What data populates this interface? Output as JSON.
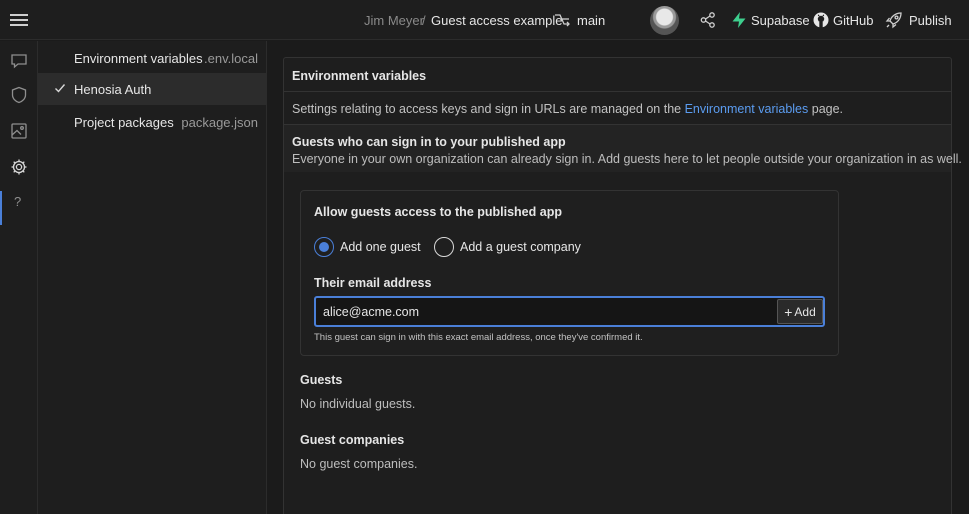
{
  "topbar": {
    "owner": "Jim Meyer",
    "separator": "/",
    "project": "Guest access example",
    "branch": "main",
    "actions": [
      {
        "label": "Supabase",
        "icon": "supabase-icon"
      },
      {
        "label": "GitHub",
        "icon": "github-icon"
      },
      {
        "label": "Publish",
        "icon": "rocket-icon"
      }
    ]
  },
  "rail": {
    "icons": [
      "chat-icon",
      "shield-icon",
      "image-icon",
      "gear-icon",
      "help-icon"
    ],
    "help_glyph": "?"
  },
  "settings": {
    "items": [
      {
        "label": "Environment variables",
        "meta": ".env.local"
      },
      {
        "label": "Henosia Auth",
        "meta": ""
      },
      {
        "label": "Project packages",
        "meta": "package.json"
      }
    ]
  },
  "panel": {
    "title": "Environment variables",
    "desc_before": "Settings relating to access keys and sign in URLs are managed on the ",
    "desc_link": "Environment variables",
    "desc_after": " page.",
    "section_title": "Guests who can sign in to your published app",
    "section_sub": "Everyone in your own organization can already sign in. Add guests here to let people outside your organization in as well.",
    "card": {
      "title": "Allow guests access to the published app",
      "option_guest": "Add one guest",
      "option_company": "Add a guest company",
      "email_label": "Their email address",
      "email_value": "alice@acme.com",
      "add_label": "Add",
      "add_glyph": "+",
      "hint": "This guest can sign in with this exact email address, once they've confirmed it."
    },
    "guests_title": "Guests",
    "guests_empty": "No individual guests.",
    "companies_title": "Guest companies",
    "companies_empty": "No guest companies."
  },
  "colors": {
    "accent": "#4a7fd8",
    "link": "#5b9cf0",
    "supabase": "#3ecf8e",
    "background": "#1b1b1b"
  }
}
